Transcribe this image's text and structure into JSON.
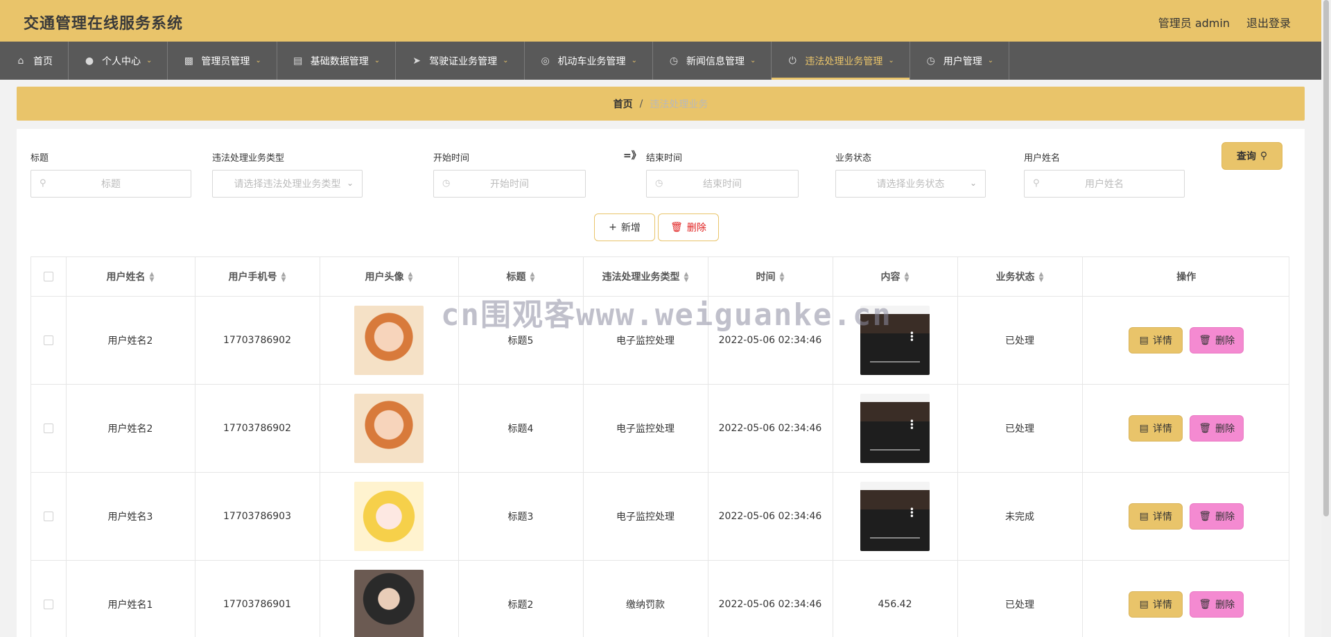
{
  "header": {
    "title": "交通管理在线服务系统",
    "user": "管理员 admin",
    "logout": "退出登录"
  },
  "nav": [
    {
      "label": "首页",
      "icon": "home-icon",
      "dropdown": false
    },
    {
      "label": "个人中心",
      "icon": "user-icon",
      "dropdown": true
    },
    {
      "label": "管理员管理",
      "icon": "monitor-icon",
      "dropdown": true
    },
    {
      "label": "基础数据管理",
      "icon": "clipboard-icon",
      "dropdown": true
    },
    {
      "label": "驾驶证业务管理",
      "icon": "send-icon",
      "dropdown": true
    },
    {
      "label": "机动车业务管理",
      "icon": "wheel-icon",
      "dropdown": true
    },
    {
      "label": "新闻信息管理",
      "icon": "gauge-icon",
      "dropdown": true
    },
    {
      "label": "违法处理业务管理",
      "icon": "power-icon",
      "dropdown": true,
      "active": true
    },
    {
      "label": "用户管理",
      "icon": "clock-icon",
      "dropdown": true
    }
  ],
  "breadcrumb": {
    "home": "首页",
    "sep": "/",
    "current": "违法处理业务"
  },
  "filters": {
    "title_label": "标题",
    "title_placeholder": "标题",
    "type_label": "违法处理业务类型",
    "type_placeholder": "请选择违法处理业务类型",
    "start_label": "开始时间",
    "start_placeholder": "开始时间",
    "range_sep": "=》",
    "end_label": "结束时间",
    "end_placeholder": "结束时间",
    "status_label": "业务状态",
    "status_placeholder": "请选择业务状态",
    "name_label": "用户姓名",
    "name_placeholder": "用户姓名",
    "query": "查询"
  },
  "actions": {
    "add": "新增",
    "delete": "删除"
  },
  "table": {
    "columns": [
      "用户姓名",
      "用户手机号",
      "用户头像",
      "标题",
      "违法处理业务类型",
      "时间",
      "内容",
      "业务状态",
      "操作"
    ],
    "rows": [
      {
        "name": "用户姓名2",
        "phone": "17703786902",
        "avatar": "av-a",
        "title": "标题5",
        "type": "电子监控处理",
        "time": "2022-05-06 02:34:46",
        "content_kind": "video",
        "content": "",
        "status": "已处理"
      },
      {
        "name": "用户姓名2",
        "phone": "17703786902",
        "avatar": "av-a",
        "title": "标题4",
        "type": "电子监控处理",
        "time": "2022-05-06 02:34:46",
        "content_kind": "video",
        "content": "",
        "status": "已处理"
      },
      {
        "name": "用户姓名3",
        "phone": "17703786903",
        "avatar": "av-b",
        "title": "标题3",
        "type": "电子监控处理",
        "time": "2022-05-06 02:34:46",
        "content_kind": "video",
        "content": "",
        "status": "未完成"
      },
      {
        "name": "用户姓名1",
        "phone": "17703786901",
        "avatar": "av-c",
        "title": "标题2",
        "type": "缴纳罚款",
        "time": "2022-05-06 02:34:46",
        "content_kind": "text",
        "content": "456.42",
        "status": "已处理"
      }
    ],
    "detail": "详情",
    "delete": "删除"
  },
  "watermark": "cn围观客www.weiguanke.cn"
}
